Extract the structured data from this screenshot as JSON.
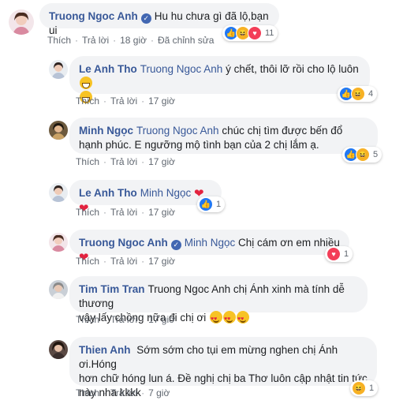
{
  "comments": [
    {
      "author": "Truong Ngoc Anh",
      "verified": true,
      "text": "Hu hu chưa gì đã lộ,bạn ui",
      "actions": [
        "Thích",
        "Trả lời",
        "18 giờ",
        "Đã chỉnh sửa"
      ],
      "reaction_count": "11",
      "reactions": [
        "like-icon",
        "haha-icon",
        "love-icon"
      ]
    },
    {
      "author": "Le Anh Tho",
      "mention": "Truong Ngoc Anh",
      "text": " ý chết, thôi lỡ rồi cho lộ luôn",
      "actions": [
        "Thích",
        "Trả lời",
        "17 giờ"
      ],
      "reaction_count": "4",
      "reactions": [
        "like-icon",
        "haha-icon"
      ]
    },
    {
      "author": "Minh Ngọc",
      "mention": "Truong Ngoc Anh",
      "text": " chúc chị tìm được bến đổ hạnh phúc. E ngưỡng mộ tình bạn của 2 chị lắm ạ.",
      "actions": [
        "Thích",
        "Trả lời",
        "17 giờ"
      ],
      "reaction_count": "5",
      "reactions": [
        "like-icon",
        "haha-icon"
      ]
    },
    {
      "author": "Le Anh Tho",
      "mention": "Minh Ngọc",
      "text": "",
      "actions": [
        "Thích",
        "Trả lời",
        "17 giờ"
      ],
      "reaction_count": "1",
      "reactions": [
        "like-icon"
      ]
    },
    {
      "author": "Truong Ngoc Anh",
      "verified": true,
      "mention": "Minh Ngọc",
      "text": " Chị cám ơn em nhiều",
      "actions": [
        "Thích",
        "Trả lời",
        "17 giờ"
      ],
      "reaction_count": "1",
      "reactions": [
        "love-icon"
      ]
    },
    {
      "author": "Tim Tim Tran",
      "mention": "Truong Ngoc Anh",
      "text_line1": " chị Ánh xinh mà tính dễ thương",
      "text_line2": "vậy lấy chồng nữa đi chị ơi",
      "actions": [
        "Thích",
        "Trả lời",
        "17 giờ"
      ]
    },
    {
      "author": "Thien Anh",
      "text_line1": " Sớm sớm cho tụi em mừng nghen chị Ánh ơi.Hóng",
      "text_line2": "hơn chữ hóng lun á. Đề nghị chị ba Thơ luôn cập nhật tin tức",
      "text_line3": "này nha kkkk",
      "actions": [
        "Thích",
        "Trả lời",
        "7 giờ"
      ],
      "reaction_count": "1",
      "reactions": [
        "haha-icon"
      ]
    }
  ],
  "colors": {
    "link": "#385898",
    "bubble": "#f2f3f5",
    "like": "#2078f4",
    "love": "#f33e58",
    "haha": "#f7b125"
  }
}
